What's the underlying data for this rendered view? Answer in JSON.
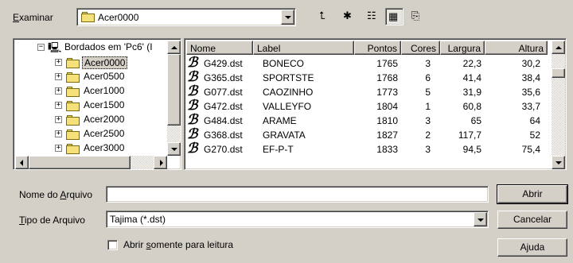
{
  "look_in": {
    "label_prefix": "",
    "label_mnemonic": "E",
    "label_rest": "xaminar",
    "value": "Acer0000"
  },
  "toolbar": [
    {
      "name": "up-folder-icon",
      "glyph": "⮤"
    },
    {
      "name": "new-folder-icon",
      "glyph": "✱"
    },
    {
      "name": "list-view-icon",
      "glyph": "☷"
    },
    {
      "name": "details-view-icon",
      "glyph": "▦"
    },
    {
      "name": "preview-icon",
      "glyph": "⎘"
    }
  ],
  "tree": {
    "root": "Bordados em 'Pc6' (I",
    "folders": [
      "Acer0000",
      "Acer0500",
      "Acer1000",
      "Acer1500",
      "Acer2000",
      "Acer2500",
      "Acer3000"
    ],
    "selected_index": 0
  },
  "list": {
    "columns": [
      "Nome",
      "Label",
      "Pontos",
      "Cores",
      "Largura",
      "Altura"
    ],
    "icon_glyph": "ℬ",
    "rows": [
      [
        "G429.dst",
        "BONECO",
        "1765",
        "3",
        "22,3",
        "30,2"
      ],
      [
        "G365.dst",
        "SPORTSTE",
        "1768",
        "6",
        "41,4",
        "38,4"
      ],
      [
        "G077.dst",
        "CAOZINHO",
        "1773",
        "5",
        "31,9",
        "35,6"
      ],
      [
        "G472.dst",
        "VALLEYFO",
        "1804",
        "1",
        "60,8",
        "33,7"
      ],
      [
        "G484.dst",
        "ARAME",
        "1810",
        "3",
        "65",
        "64"
      ],
      [
        "G368.dst",
        "GRAVATA",
        "1827",
        "2",
        "117,7",
        "52"
      ],
      [
        "G270.dst",
        "EF-P-T",
        "1833",
        "3",
        "94,5",
        "75,4"
      ]
    ]
  },
  "filename": {
    "label_prefix": "Nome do ",
    "label_mnemonic": "A",
    "label_rest": "rquivo",
    "value": ""
  },
  "filetype": {
    "label_prefix": "",
    "label_mnemonic": "T",
    "label_rest": "ipo de Arquivo",
    "value": "Tajima (*.dst)"
  },
  "readonly": {
    "label_prefix": "Abrir ",
    "label_mnemonic": "s",
    "label_rest": "omente para leitura",
    "checked": false
  },
  "buttons": {
    "open": "Abrir",
    "cancel": "Cancelar",
    "help": "Ajuda"
  },
  "colors": {
    "face": "#d4d0c8",
    "folder": "#f5e17a"
  }
}
